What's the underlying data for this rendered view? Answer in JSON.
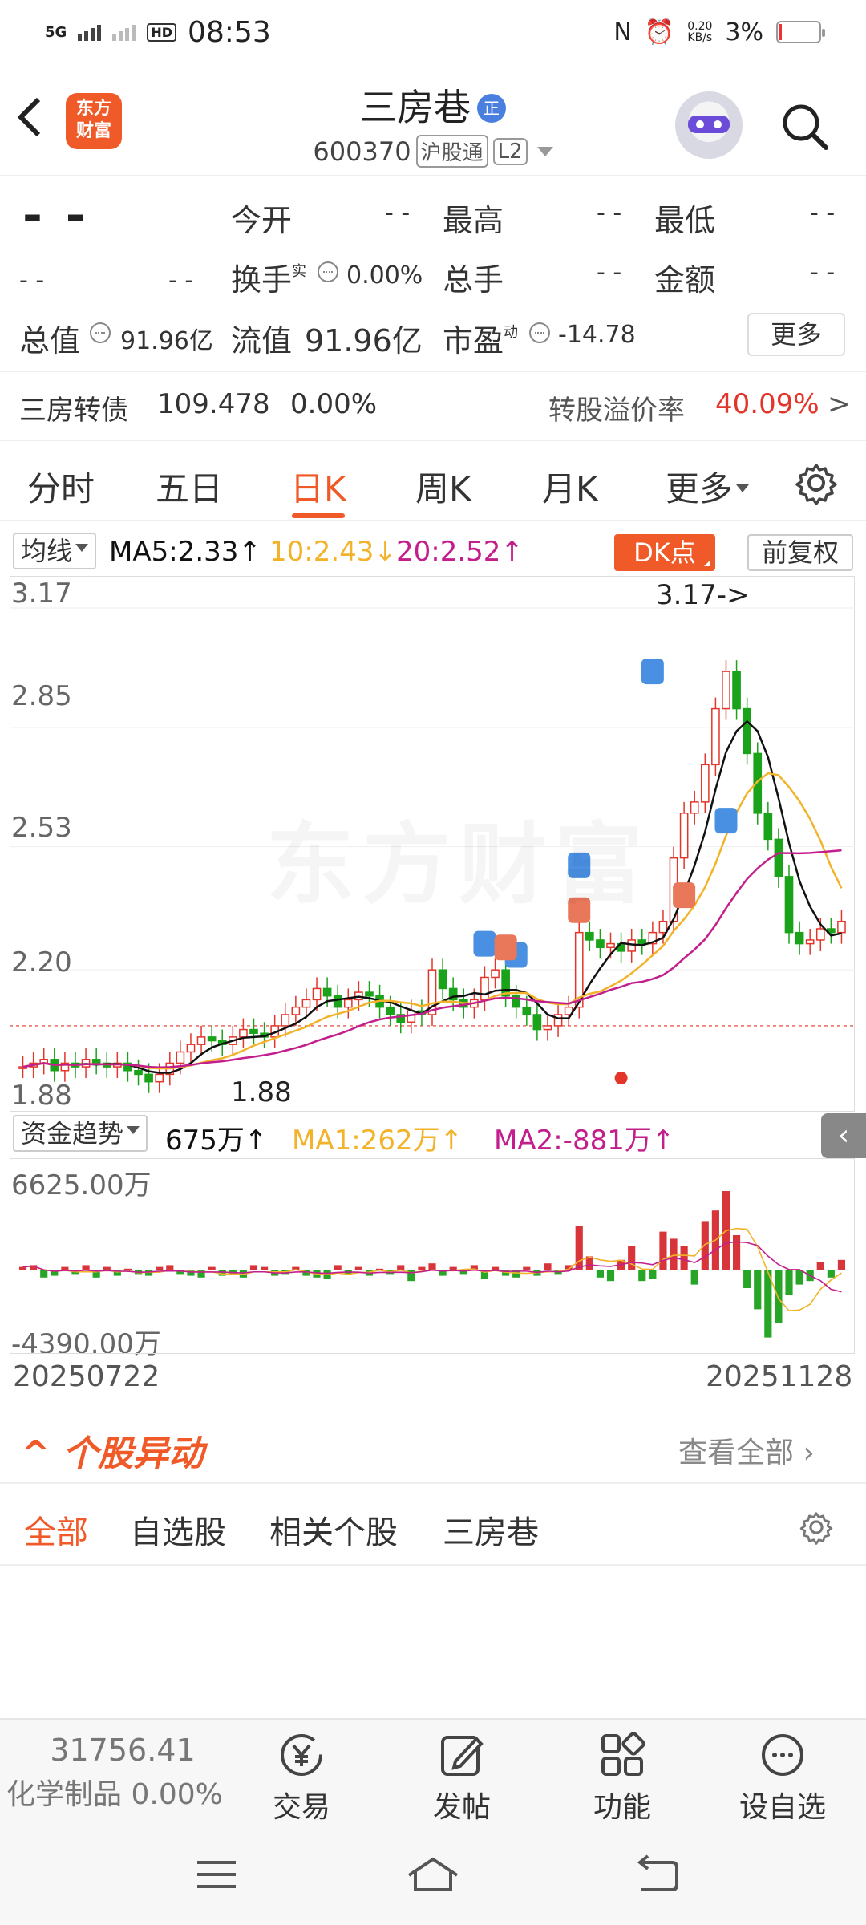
{
  "status_bar": {
    "signal": "5G",
    "time": "08:53",
    "speed_value": "0.20",
    "speed_unit": "KB/s",
    "battery": "3%"
  },
  "header": {
    "logo_line1": "东方",
    "logo_line2": "财富",
    "stock_name": "三房巷",
    "badge": "正",
    "code": "600370",
    "tag_connect": "沪股通",
    "tag_level": "L2"
  },
  "quote": {
    "price": "- -",
    "change1": "- -",
    "change2": "- -",
    "open_label": "今开",
    "open_value": "- -",
    "high_label": "最高",
    "high_value": "- -",
    "low_label": "最低",
    "low_value": "- -",
    "turnover_label": "换手",
    "turnover_sup": "实",
    "turnover_value": "0.00%",
    "volume_label": "总手",
    "volume_value": "- -",
    "amount_label": "金额",
    "amount_value": "- -",
    "mktcap_label": "总值",
    "mktcap_value": "91.96亿",
    "float_label": "流值",
    "float_value": "91.96亿",
    "pe_label": "市盈",
    "pe_sup": "动",
    "pe_value": "-14.78",
    "more_btn": "更多"
  },
  "bond": {
    "name": "三房转债",
    "price": "109.478",
    "change": "0.00%",
    "premium_label": "转股溢价率",
    "premium_value": "40.09%",
    "arrow": ">"
  },
  "tabs": {
    "items": [
      "分时",
      "五日",
      "日K",
      "周K",
      "月K",
      "更多"
    ],
    "active_index": 2
  },
  "ma_bar": {
    "select_label": "均线",
    "ma5": "MA5:2.33↑",
    "ma10": "10:2.43↓",
    "ma20": "20:2.52↑",
    "dk_btn": "DK点",
    "fq_btn": "前复权"
  },
  "kchart": {
    "y_labels": [
      "3.17",
      "2.85",
      "2.53",
      "2.20",
      "1.88"
    ],
    "max_marker": "3.17->",
    "min_marker": "1.88",
    "watermark": "东方财富",
    "colors": {
      "up": "#e3352a",
      "down": "#1aa31a",
      "ma5": "#111111",
      "ma10": "#f2b32a",
      "ma20": "#c21e8c",
      "buy": "#e9775a",
      "sell": "#4a90e2"
    }
  },
  "fund_bar": {
    "select_label": "资金趋势",
    "value": "675万↑",
    "ma1": "MA1:262万↑",
    "ma2": "MA2:-881万↑",
    "top_label": "6625.00万",
    "bottom_label": "-4390.00万"
  },
  "dates": {
    "start": "20250722",
    "end": "20251128"
  },
  "section": {
    "title": "个股异动",
    "view_all": "查看全部"
  },
  "filter_tabs": [
    "全部",
    "自选股",
    "相关个股",
    "三房巷"
  ],
  "bottom_bar": {
    "index_value": "31756.41",
    "index_name": "化学制品",
    "index_change": "0.00%",
    "buttons": [
      "交易",
      "发帖",
      "功能",
      "设自选"
    ]
  },
  "chart_data": {
    "type": "candlestick",
    "title": "",
    "x_range": [
      "20250722",
      "20251128"
    ],
    "y_range": [
      1.88,
      3.17
    ],
    "ma": {
      "MA5": 2.33,
      "MA10": 2.43,
      "MA20": 2.52
    },
    "high": 3.17,
    "low": 1.88,
    "close_series_approx": [
      1.94,
      1.95,
      1.96,
      1.93,
      1.95,
      1.94,
      1.96,
      1.95,
      1.94,
      1.95,
      1.93,
      1.92,
      1.9,
      1.92,
      1.95,
      1.98,
      2.0,
      2.02,
      2.01,
      2.0,
      2.02,
      2.04,
      2.03,
      2.02,
      2.05,
      2.08,
      2.1,
      2.12,
      2.15,
      2.13,
      2.1,
      2.12,
      2.14,
      2.13,
      2.1,
      2.08,
      2.06,
      2.09,
      2.08,
      2.2,
      2.15,
      2.12,
      2.1,
      2.12,
      2.18,
      2.2,
      2.13,
      2.1,
      2.08,
      2.04,
      2.05,
      2.08,
      2.1,
      2.3,
      2.28,
      2.26,
      2.27,
      2.25,
      2.28,
      2.27,
      2.3,
      2.33,
      2.5,
      2.62,
      2.65,
      2.75,
      2.9,
      3.0,
      2.9,
      2.78,
      2.62,
      2.55,
      2.45,
      2.3,
      2.27,
      2.28,
      2.31,
      2.3,
      2.33
    ],
    "fund_flow_range": [
      -4390,
      6625
    ],
    "fund_flow_unit": "万"
  }
}
